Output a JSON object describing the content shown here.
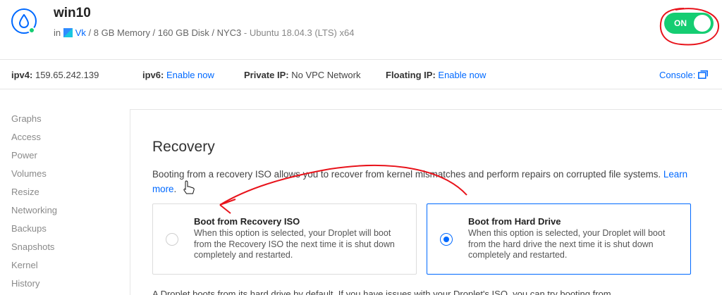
{
  "header": {
    "title": "win10",
    "in_label": "in",
    "project": "Vk",
    "specs": " / 8 GB Memory / 160 GB Disk / NYC3",
    "os": " - Ubuntu 18.04.3 (LTS) x64",
    "power_toggle": "ON"
  },
  "infobar": {
    "ipv4_label": "ipv4:",
    "ipv4_value": "159.65.242.139",
    "ipv6_label": "ipv6:",
    "ipv6_action": "Enable now",
    "private_label": "Private IP:",
    "private_value": "No VPC Network",
    "floating_label": "Floating IP:",
    "floating_action": "Enable now",
    "console_label": "Console:"
  },
  "sidebar": {
    "items": [
      "Graphs",
      "Access",
      "Power",
      "Volumes",
      "Resize",
      "Networking",
      "Backups",
      "Snapshots",
      "Kernel",
      "History"
    ]
  },
  "recovery": {
    "title": "Recovery",
    "description": "Booting from a recovery ISO allows you to recover from kernel mismatches and perform repairs on corrupted file systems.",
    "learn_more": "Learn more",
    "period": ".",
    "options": [
      {
        "title": "Boot from Recovery ISO",
        "description": "When this option is selected, your Droplet will boot from the Recovery ISO the next time it is shut down completely and restarted.",
        "selected": false
      },
      {
        "title": "Boot from Hard Drive",
        "description": "When this option is selected, your Droplet will boot from the hard drive the next time it is shut down completely and restarted.",
        "selected": true
      }
    ],
    "footer_text": "A Droplet boots from its hard drive by default. If you have issues with your Droplet's ISO, you can try booting from"
  },
  "colors": {
    "accent": "#0069ff",
    "on_green": "#15cd72",
    "annotation_red": "#e8131b"
  },
  "icons": [
    "droplet-icon",
    "project-icon",
    "external-window-icon",
    "hand-cursor-icon",
    "radio-icon"
  ]
}
